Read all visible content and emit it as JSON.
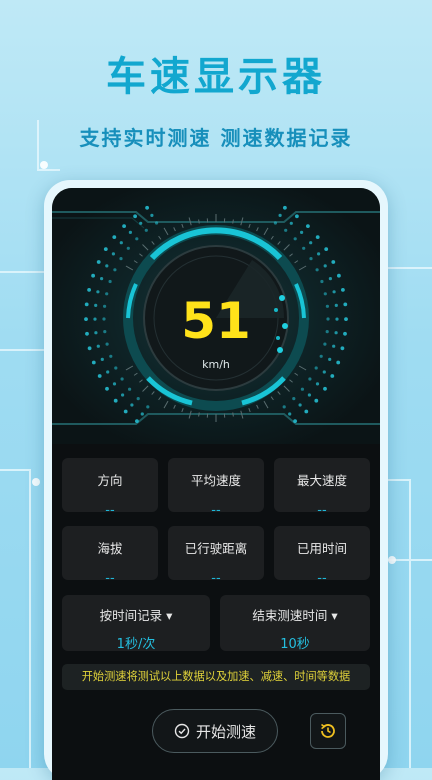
{
  "promo": {
    "title": "车速显示器",
    "subtitle": "支持实时测速  测速数据记录"
  },
  "gauge": {
    "speed": "51",
    "unit": "km/h"
  },
  "stats": [
    {
      "label": "方向",
      "value": "--"
    },
    {
      "label": "平均速度",
      "value": "--"
    },
    {
      "label": "最大速度",
      "value": "--"
    },
    {
      "label": "海拔",
      "value": "--"
    },
    {
      "label": "已行驶距离",
      "value": "--"
    },
    {
      "label": "已用时间",
      "value": "--"
    }
  ],
  "settings": {
    "record_mode": {
      "label": "按时间记录 ▾",
      "value": "1秒/次"
    },
    "end_time": {
      "label": "结束测速时间 ▾",
      "value": "10秒"
    }
  },
  "tip": "开始测速将测试以上数据以及加速、减速、时间等数据",
  "actions": {
    "start_label": "开始测速"
  },
  "colors": {
    "accent": "#1fb6d6",
    "speed": "#ffe21a",
    "tip_text": "#e0d23a"
  },
  "icons": {
    "start": "check-circle-icon",
    "history": "history-icon"
  }
}
